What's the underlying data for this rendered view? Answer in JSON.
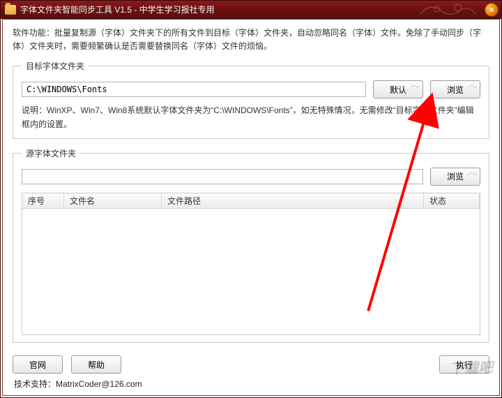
{
  "window": {
    "title": "字体文件夹智能同步工具 V1.5 - 中学生学习报社专用"
  },
  "description": "软件功能：批量复制源（字体）文件夹下的所有文件到目标（字体）文件夹，自动忽略同名（字体）文件。免除了手动同步（字体）文件夹时，需要频繁确认是否需要替换同名（字体）文件的烦恼。",
  "target_group": {
    "legend": "目标字体文件夹",
    "path_value": "C:\\WINDOWS\\Fonts",
    "default_btn": "默认",
    "browse_btn": "浏览",
    "note": "说明：WinXP、Win7、Win8系统默认字体文件夹为“C:\\WINDOWS\\Fonts”，如无特殊情况，无需修改“目标字体文件夹”编辑框内的设置。"
  },
  "source_group": {
    "legend": "源字体文件夹",
    "path_value": "",
    "browse_btn": "浏览",
    "columns": {
      "seq": "序号",
      "name": "文件名",
      "path": "文件路径",
      "status": "状态"
    }
  },
  "bottom": {
    "website_btn": "官网",
    "help_btn": "帮助",
    "execute_btn": "执行"
  },
  "support_label": "技术支持：",
  "support_email": "MatrixCoder@126.com",
  "watermark": "下载吧"
}
